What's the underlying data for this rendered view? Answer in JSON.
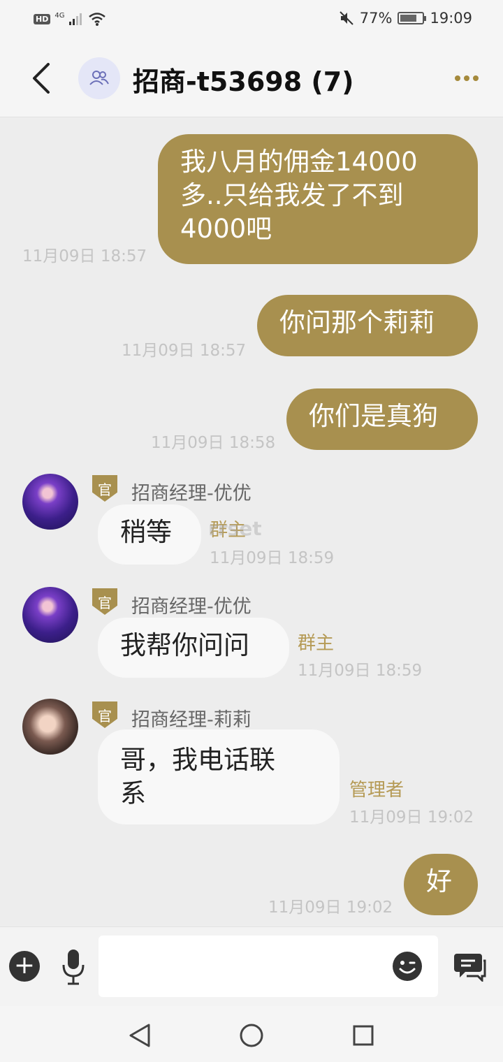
{
  "status_bar": {
    "hd": "HD",
    "network": "4G",
    "battery": "77%",
    "battery_level": 0.77,
    "time": "19:09"
  },
  "header": {
    "title": "招商-t53698 (7)",
    "back_icon": "chevron-left-icon",
    "group_icon": "group-icon",
    "more_icon": "more-dots-icon"
  },
  "messages": [
    {
      "direction": "out",
      "text": "我八月的佣金14000多..只给我发了不到4000吧",
      "lines": [
        "我八月的佣金14000",
        "多..只给我发了不到",
        "4000吧"
      ],
      "time": "11月09日 18:57"
    },
    {
      "direction": "out",
      "text": "你问那个莉莉",
      "time": "11月09日 18:57"
    },
    {
      "direction": "out",
      "text": "你们是真狗",
      "time": "11月09日 18:58"
    },
    {
      "direction": "in",
      "badge": "官",
      "sender": "招商经理-优优",
      "role": "群主",
      "text": "稍等",
      "time": "11月09日 18:59"
    },
    {
      "direction": "in",
      "badge": "官",
      "sender": "招商经理-优优",
      "role": "群主",
      "text": "我帮你问问",
      "time": "11月09日 18:59"
    },
    {
      "direction": "in",
      "badge": "官",
      "sender": "招商经理-莉莉",
      "role": "管理者",
      "text": "哥，我电话联系",
      "lines": [
        "哥，我电话联",
        "系"
      ],
      "time": "11月09日 19:02"
    },
    {
      "direction": "out",
      "text": "好",
      "time": "11月09日 19:02"
    }
  ],
  "watermark": "rrset",
  "input": {
    "placeholder": "",
    "plus_icon": "plus-icon",
    "mic_icon": "microphone-icon",
    "emoji_icon": "emoji-icon",
    "quick_reply_icon": "message-icon"
  },
  "colors": {
    "accent": "#a8904f",
    "background": "#ededed",
    "incoming_bubble": "#f8f8f8",
    "role_text": "#b59a55"
  }
}
